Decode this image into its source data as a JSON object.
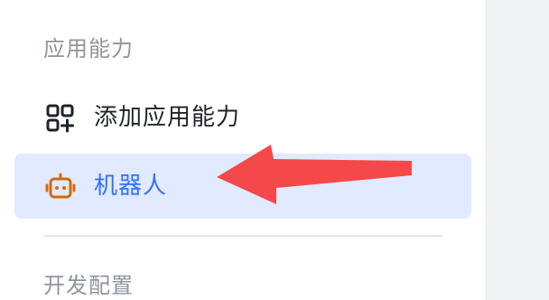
{
  "sidebar": {
    "sections": [
      {
        "title": "应用能力",
        "items": [
          {
            "label": "添加应用能力",
            "icon": "add-app-capability-icon",
            "active": false
          },
          {
            "label": "机器人",
            "icon": "robot-icon",
            "active": true
          }
        ]
      },
      {
        "title": "开发配置"
      }
    ]
  },
  "colors": {
    "active_bg": "#e1eaff",
    "active_text": "#3370ff",
    "robot_icon": "#d46b08",
    "annotation_arrow": "#f5484a"
  }
}
